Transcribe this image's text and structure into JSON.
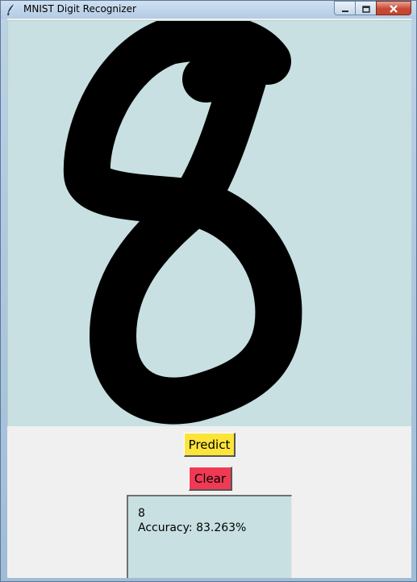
{
  "window": {
    "title": "MNIST Digit Recognizer"
  },
  "icons": {
    "app": "feather-icon",
    "minimize": "minimize-icon",
    "maximize": "maximize-icon",
    "close": "close-icon"
  },
  "canvas": {
    "background": "#c8e0e1",
    "stroke_color": "#000000",
    "drawn_digit": "8"
  },
  "buttons": {
    "predict": {
      "label": "Predict",
      "color": "#fde43a"
    },
    "clear": {
      "label": "Clear",
      "color": "#f03a55"
    }
  },
  "result": {
    "prediction": "8",
    "accuracy_text": "Accuracy: 83.263%"
  },
  "colors": {
    "panel": "#f0f0f0",
    "output_bg": "#c8e0e1"
  }
}
